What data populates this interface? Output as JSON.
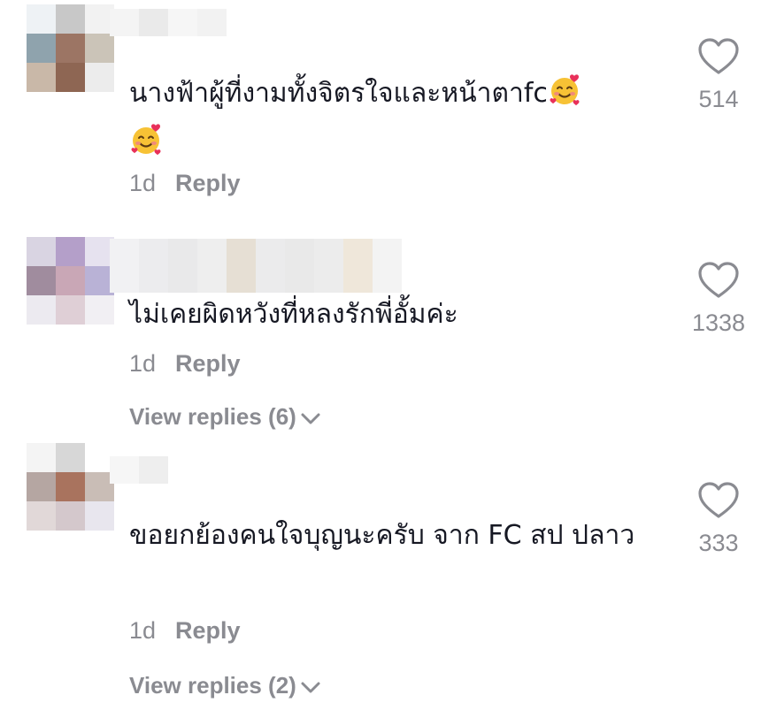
{
  "comments": [
    {
      "avatar_colors": [
        "#eef2f5",
        "#c8c8c8",
        "#f2f2f2",
        "#8fa3ad",
        "#9c7564",
        "#cbc4b8",
        "#c9b8a8",
        "#8e6653",
        "#ececec"
      ],
      "name_colors": [
        "#f4f4f4",
        "#eaeaea",
        "#f6f6f6",
        "#f2f2f2"
      ],
      "text": "นางฟ้าผู้ที่งามทั้งจิตรใจและหน้าตาfc",
      "emoji": "smiling-face-with-hearts",
      "time": "1d",
      "reply": "Reply",
      "likes": "514"
    },
    {
      "avatar_colors": [
        "#d9d4e2",
        "#b49fc9",
        "#e6e2ef",
        "#a08c9e",
        "#c9a7b6",
        "#b9b2d6",
        "#eceaf0",
        "#dfcfd6",
        "#f1eff3"
      ],
      "name_colors": [
        "#f1f1f3",
        "#ececee",
        "#e9e9ea",
        "#eeeeee",
        "#e6dfd4",
        "#ebebec",
        "#e9e9e9",
        "#ececec",
        "#efe7da",
        "#f3f3f3"
      ],
      "text": "ไม่เคยผิดหวังที่หลงรักพี่อั้มค่ะ",
      "time": "1d",
      "reply": "Reply",
      "likes": "1338",
      "view_replies": "View replies (6)"
    },
    {
      "avatar_colors": [
        "#f4f4f4",
        "#d7d7d7",
        "#ffffff",
        "#b5a6a2",
        "#a9735e",
        "#c9bdb6",
        "#e1d8d8",
        "#d4c8cc",
        "#e8e6ee"
      ],
      "name_colors": [
        "#f6f6f6",
        "#eeeeee"
      ],
      "text": "ขอยกย้องคนใจบุญนะครับ จาก FC สป ปลาว",
      "time": "1d",
      "reply": "Reply",
      "likes": "333",
      "view_replies": "View replies (2)"
    }
  ],
  "colors": {
    "muted": "#8a8b91",
    "text": "#161823",
    "heart": "#8a8b91"
  },
  "icons": {
    "like": "heart-outline-icon",
    "expand": "chevron-down-icon"
  }
}
